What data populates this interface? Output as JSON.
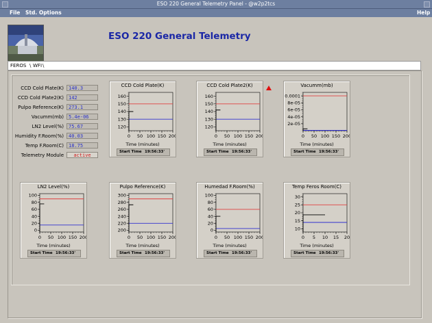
{
  "window": {
    "title": "ESO 220 General Telemetry Panel - @w2p2tcs"
  },
  "menu": {
    "file": "File",
    "std_options": "Std. Options",
    "help": "Help"
  },
  "header": {
    "title": "ESO 220 General Telemetry"
  },
  "tabs": [
    {
      "label": "FEROS"
    },
    {
      "label": "WFI"
    }
  ],
  "readouts": [
    {
      "label": "CCD Cold Plate(K)",
      "value": "140.3"
    },
    {
      "label": "CCD Cold Plate2(K)",
      "value": "142"
    },
    {
      "label": "Pulpo Reference(K)",
      "value": "273.1"
    },
    {
      "label": "Vacumm(mb)",
      "value": "5.4e-06"
    },
    {
      "label": "LN2 Level(%)",
      "value": "75.67"
    },
    {
      "label": "Humidity F.Room(%)",
      "value": "40.03"
    },
    {
      "label": "Temp F.Room(C)",
      "value": "18.75"
    },
    {
      "label": "Telemetry Module",
      "value": "active"
    }
  ],
  "start_time": {
    "label": "Start Time",
    "value": "19:56:33'"
  },
  "colors": {
    "upper_limit": "#e04040",
    "lower_limit": "#3030d0",
    "trace": "#000000",
    "alarm": "#e01010",
    "title": "#1a27a6"
  },
  "chart_data": [
    {
      "type": "line",
      "title": "CCD Cold Plate(K)",
      "xlabel": "Time (minutes)",
      "ylabel": "",
      "xlim": [
        0,
        200
      ],
      "ylim": [
        115,
        165
      ],
      "xticks": [
        "0",
        "50",
        "100",
        "150",
        "200"
      ],
      "yticks": [
        "120",
        "130",
        "140",
        "150",
        "160"
      ],
      "series": [
        {
          "values": [
            [
              0,
              150
            ],
            [
              200,
              150
            ]
          ]
        },
        {
          "values": [
            [
              0,
              130
            ],
            [
              200,
              130
            ]
          ]
        },
        {
          "values": [
            [
              0,
              140
            ],
            [
              20,
              140
            ]
          ]
        }
      ]
    },
    {
      "type": "line",
      "title": "CCD Cold Plate2(K)",
      "xlabel": "Time (minutes)",
      "ylabel": "",
      "alarm": true,
      "xlim": [
        0,
        200
      ],
      "ylim": [
        115,
        165
      ],
      "xticks": [
        "0",
        "50",
        "100",
        "150",
        "200"
      ],
      "yticks": [
        "120",
        "130",
        "140",
        "150",
        "160"
      ],
      "series": [
        {
          "values": [
            [
              0,
              150
            ],
            [
              200,
              150
            ]
          ]
        },
        {
          "values": [
            [
              0,
              130
            ],
            [
              200,
              130
            ]
          ]
        },
        {
          "values": [
            [
              0,
              142
            ],
            [
              20,
              142
            ]
          ]
        }
      ]
    },
    {
      "type": "line",
      "title": "Vacumm(mb)",
      "xlabel": "Time (minutes)",
      "ylabel": "",
      "xlim": [
        0,
        200
      ],
      "ylim": [
        0,
        0.00011
      ],
      "xticks": [
        "0",
        "50",
        "100",
        "150",
        "200"
      ],
      "ytickvals": [
        0.0001,
        8e-05,
        6e-05,
        4e-05,
        2e-05
      ],
      "yticks": [
        "0.0001",
        "8e-05",
        "6e-05",
        "4e-05",
        "2e-05"
      ],
      "series": [
        {
          "values": [
            [
              0,
              0.0001
            ],
            [
              200,
              0.0001
            ]
          ]
        },
        {
          "values": [
            [
              0,
              1e-06
            ],
            [
              200,
              1e-06
            ]
          ]
        },
        {
          "values": [
            [
              0,
              5.4e-06
            ],
            [
              20,
              5.4e-06
            ]
          ]
        }
      ]
    },
    {
      "type": "line",
      "title": "LN2 Level(%)",
      "xlabel": "Time (minutes)",
      "ylabel": "",
      "xlim": [
        0,
        200
      ],
      "ylim": [
        -5,
        105
      ],
      "xticks": [
        "0",
        "50",
        "100",
        "150",
        "200"
      ],
      "yticks": [
        "0",
        "20",
        "40",
        "60",
        "80",
        "100"
      ],
      "series": [
        {
          "values": [
            [
              0,
              90
            ],
            [
              200,
              90
            ]
          ]
        },
        {
          "values": [
            [
              0,
              15
            ],
            [
              200,
              15
            ]
          ]
        },
        {
          "values": [
            [
              0,
              75.67
            ],
            [
              20,
              75.67
            ]
          ]
        }
      ]
    },
    {
      "type": "line",
      "title": "Pulpo Reference(K)",
      "xlabel": "Time (minutes)",
      "ylabel": "",
      "xlim": [
        0,
        200
      ],
      "ylim": [
        195,
        305
      ],
      "xticks": [
        "0",
        "50",
        "100",
        "150",
        "200"
      ],
      "yticks": [
        "200",
        "220",
        "240",
        "260",
        "280",
        "300"
      ],
      "series": [
        {
          "values": [
            [
              0,
              290
            ],
            [
              200,
              290
            ]
          ]
        },
        {
          "values": [
            [
              0,
              220
            ],
            [
              200,
              220
            ]
          ]
        },
        {
          "values": [
            [
              0,
              273.1
            ],
            [
              20,
              273.1
            ]
          ]
        }
      ]
    },
    {
      "type": "line",
      "title": "Humedad F.Room(%)",
      "xlabel": "Time (minutes)",
      "ylabel": "",
      "xlim": [
        0,
        200
      ],
      "ylim": [
        -5,
        105
      ],
      "xticks": [
        "0",
        "50",
        "100",
        "150",
        "200"
      ],
      "yticks": [
        "0",
        "20",
        "40",
        "60",
        "80",
        "100"
      ],
      "series": [
        {
          "values": [
            [
              0,
              60
            ],
            [
              200,
              60
            ]
          ]
        },
        {
          "values": [
            [
              0,
              5
            ],
            [
              200,
              5
            ]
          ]
        },
        {
          "values": [
            [
              0,
              40.03
            ],
            [
              20,
              40.03
            ]
          ]
        }
      ]
    },
    {
      "type": "line",
      "title": "Temp Feros Room(C)",
      "xlabel": "Time (minutes)",
      "ylabel": "",
      "xlim": [
        0,
        20
      ],
      "ylim": [
        8,
        32
      ],
      "xticks": [
        "0",
        "5",
        "10",
        "15",
        "20"
      ],
      "yticks": [
        "10",
        "15",
        "20",
        "25",
        "30"
      ],
      "series": [
        {
          "values": [
            [
              0,
              25
            ],
            [
              20,
              25
            ]
          ]
        },
        {
          "values": [
            [
              0,
              14
            ],
            [
              20,
              14
            ]
          ]
        },
        {
          "values": [
            [
              0,
              18.75
            ],
            [
              10,
              18.75
            ]
          ]
        }
      ]
    }
  ]
}
